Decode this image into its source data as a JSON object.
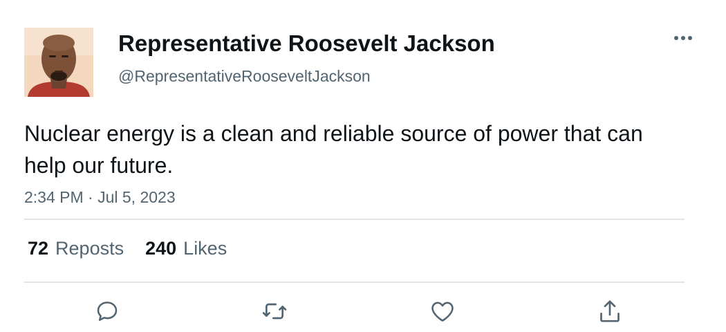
{
  "author": {
    "display_name": "Representative Roosevelt Jackson",
    "handle": "@RepresentativeRooseveltJackson",
    "avatar_icon": "profile-photo"
  },
  "tweet": {
    "text": "Nuclear energy is a clean and reliable source of power that can help our future.",
    "timestamp": "2:34 PM · Jul 5, 2023"
  },
  "stats": {
    "reposts": {
      "count": "72",
      "label": "Reposts"
    },
    "likes": {
      "count": "240",
      "label": "Likes"
    }
  },
  "actions": {
    "reply_icon": "reply-icon",
    "repost_icon": "repost-icon",
    "like_icon": "like-icon",
    "share_icon": "share-icon",
    "more_icon": "more-icon"
  },
  "colors": {
    "text_primary": "#0f1419",
    "text_secondary": "#536471",
    "icon": "#536471",
    "divider": "#e1e5e8"
  }
}
